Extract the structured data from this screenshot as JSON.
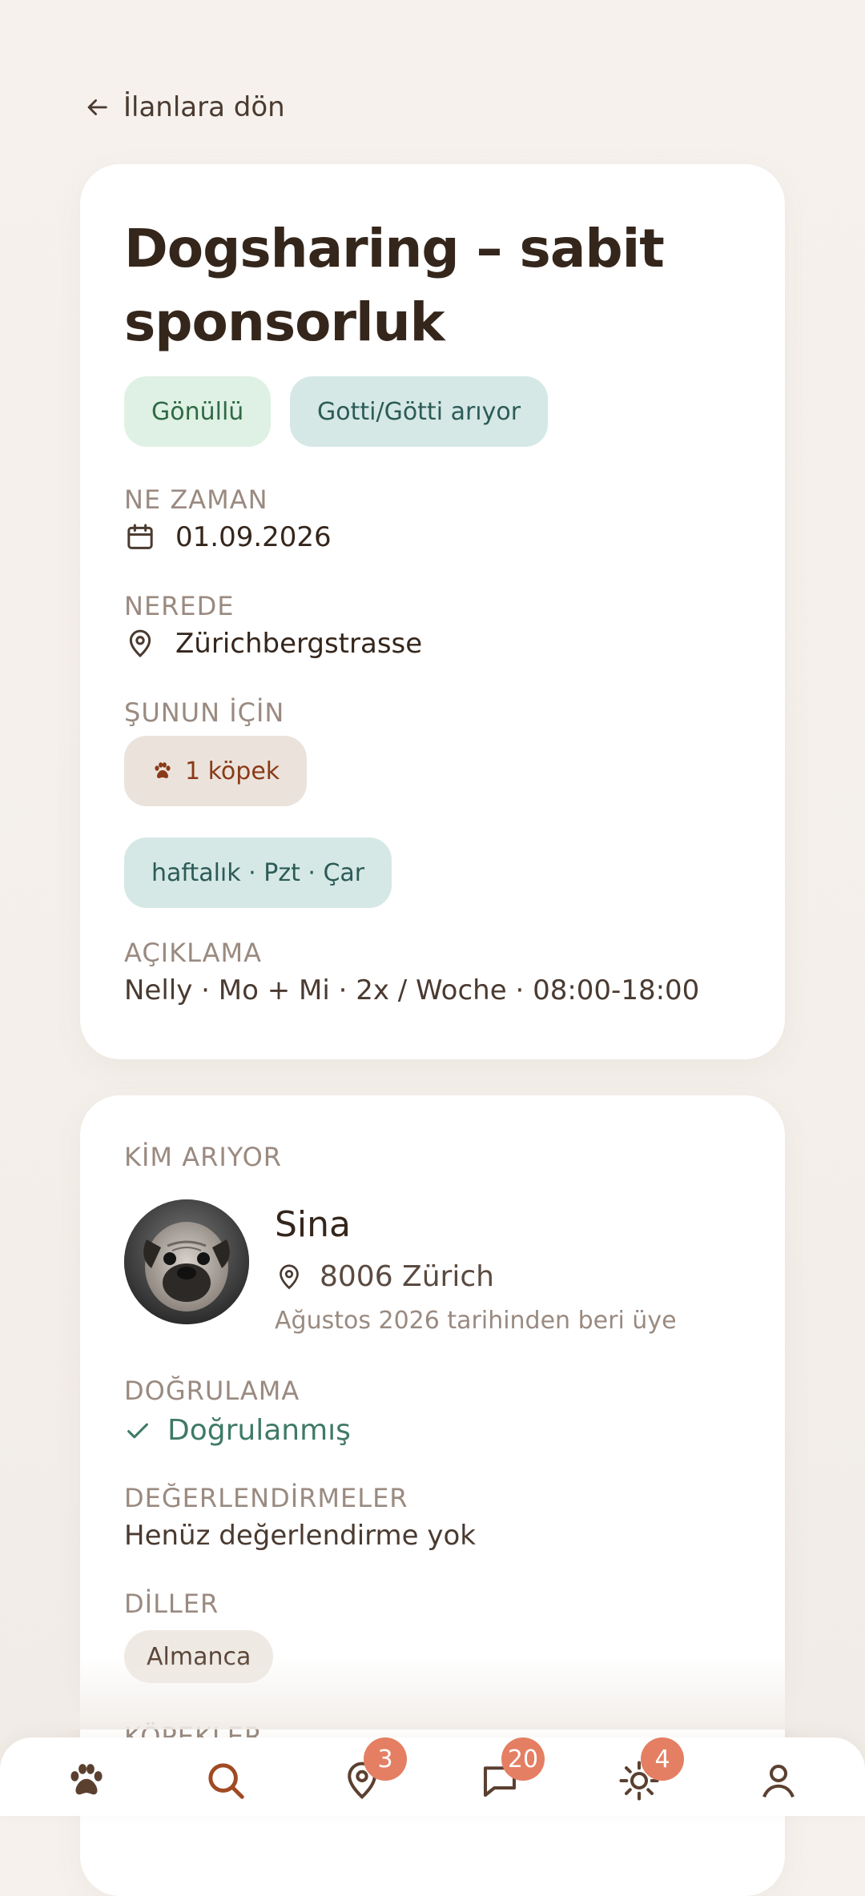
{
  "back": {
    "label": "İlanlara dön"
  },
  "listing": {
    "title": "Dogsharing – sabit sponsorluk",
    "chips": [
      "Gönüllü",
      "Gotti/Götti arıyor"
    ],
    "when_label": "NE ZAMAN",
    "when_value": "01.09.2026",
    "where_label": "NEREDE",
    "where_value": "Zürichbergstrasse",
    "for_label": "ŞUNUN İÇİN",
    "for_chip": "1 köpek",
    "schedule_chip": "haftalık · Pzt · Çar",
    "description_label": "AÇIKLAMA",
    "description": "Nelly · Mo + Mi · 2x / Woche · 08:00-18:00"
  },
  "owner": {
    "section_label": "KİM ARIYOR",
    "name": "Sina",
    "location": "8006 Zürich",
    "member_since": "Ağustos 2026 tarihinden beri üye",
    "verification_label": "DOĞRULAMA",
    "verification_value": "Doğrulanmış",
    "reviews_label": "DEĞERLENDİRMELER",
    "reviews_value": "Henüz değerlendirme yok",
    "languages_label": "DİLLER",
    "languages": [
      "Almanca"
    ],
    "dogs_label": "KÖPEKLER"
  },
  "nav": {
    "items": [
      {
        "icon": "paw-icon",
        "badge": ""
      },
      {
        "icon": "search-icon",
        "badge": ""
      },
      {
        "icon": "map-pin-icon",
        "badge": "3"
      },
      {
        "icon": "chat-icon",
        "badge": "20"
      },
      {
        "icon": "sun-icon",
        "badge": "4"
      },
      {
        "icon": "profile-icon",
        "badge": ""
      }
    ]
  },
  "colors": {
    "accent": "#8a3a18",
    "badge": "#e47f63",
    "verified": "#3f7a66",
    "chip_green": "#dff1e4",
    "chip_teal": "#d5e8e6"
  }
}
